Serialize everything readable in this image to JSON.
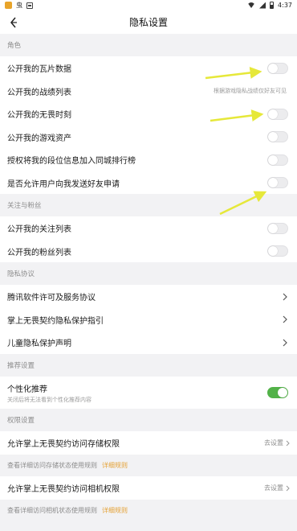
{
  "status_bar": {
    "time": "4:37",
    "app_glyph": "虫"
  },
  "header": {
    "title": "隐私设置"
  },
  "sections": {
    "role": {
      "title": "角色",
      "items": [
        {
          "label": "公开我的瓦片数据",
          "toggle": false
        },
        {
          "label": "公开我的战绩列表",
          "hint": "根据游戏隐私战绩仅好友可见"
        },
        {
          "label": "公开我的无畏时刻",
          "toggle": false
        },
        {
          "label": "公开我的游戏资产",
          "toggle": false
        },
        {
          "label": "授权将我的段位信息加入同城排行榜",
          "toggle": false
        },
        {
          "label": "是否允许用户向我发送好友申请",
          "toggle": false
        }
      ]
    },
    "follow": {
      "title": "关注与粉丝",
      "items": [
        {
          "label": "公开我的关注列表",
          "toggle": false
        },
        {
          "label": "公开我的粉丝列表",
          "toggle": false
        }
      ]
    },
    "privacy": {
      "title": "隐私协议",
      "items": [
        {
          "label": "腾讯软件许可及服务协议"
        },
        {
          "label": "掌上无畏契约隐私保护指引"
        },
        {
          "label": "儿童隐私保护声明"
        }
      ]
    },
    "recommend": {
      "title": "推荐设置",
      "item": {
        "label": "个性化推荐",
        "sub": "关闭后将无法看到个性化推荐内容",
        "toggle": true
      }
    },
    "permission": {
      "title": "权限设置",
      "storage": {
        "label": "允许掌上无畏契约访问存储权限",
        "action": "去设置"
      },
      "storage_note": {
        "text": "查看详细访问存储状态使用规则",
        "link": "详细规则"
      },
      "camera": {
        "label": "允许掌上无畏契约访问相机权限",
        "action": "去设置"
      },
      "camera_note": {
        "text": "查看详细访问相机状态使用规则",
        "link": "详细规则"
      }
    }
  },
  "colors": {
    "toggle_on": "#52b248",
    "link": "#e4a236",
    "annotation_arrow": "#e6e83a"
  }
}
